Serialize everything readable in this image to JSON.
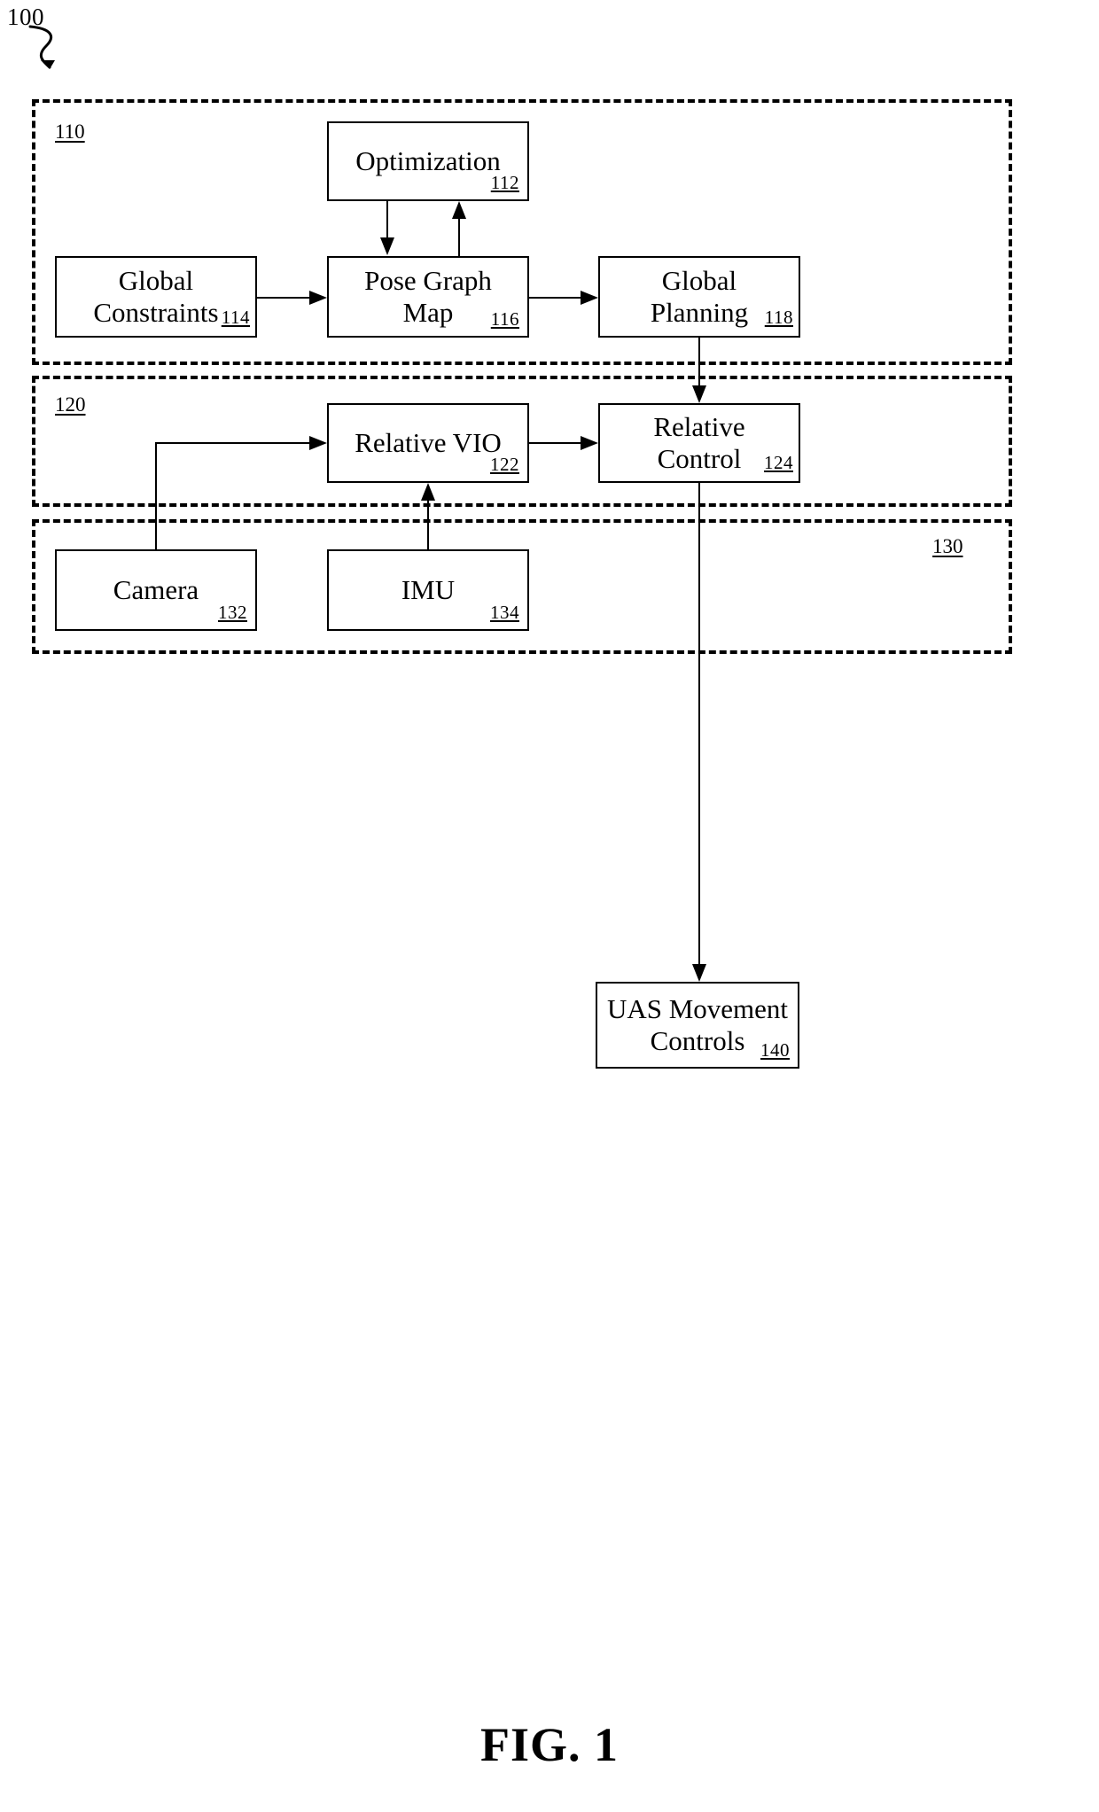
{
  "figure": {
    "system_ref": "100",
    "caption": "FIG. 1"
  },
  "groups": [
    {
      "id": "110",
      "label": "110"
    },
    {
      "id": "120",
      "label": "120"
    },
    {
      "id": "130",
      "label": "130"
    }
  ],
  "boxes": {
    "optimization": {
      "title": "Optimization",
      "ref": "112"
    },
    "global_constraints": {
      "title": "Global\nConstraints",
      "ref": "114"
    },
    "pose_graph_map": {
      "title": "Pose Graph\nMap",
      "ref": "116"
    },
    "global_planning": {
      "title": "Global\nPlanning",
      "ref": "118"
    },
    "relative_vio": {
      "title": "Relative VIO",
      "ref": "122"
    },
    "relative_control": {
      "title": "Relative\nControl",
      "ref": "124"
    },
    "camera": {
      "title": "Camera",
      "ref": "132"
    },
    "imu": {
      "title": "IMU",
      "ref": "134"
    },
    "uas_movement": {
      "title": "UAS Movement\nControls",
      "ref": "140"
    }
  },
  "colors": {
    "ink": "#000000",
    "paper": "#ffffff"
  }
}
